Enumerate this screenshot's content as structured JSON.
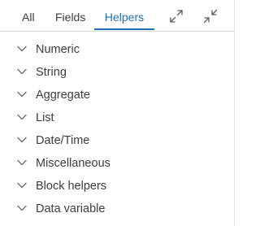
{
  "tabs": {
    "all": "All",
    "fields": "Fields",
    "helpers": "Helpers",
    "active": "helpers"
  },
  "toolbar": {
    "expand_icon": "expand-arrows-icon",
    "collapse_icon": "collapse-arrows-icon"
  },
  "helpers": {
    "items": [
      {
        "label": "Numeric"
      },
      {
        "label": "String"
      },
      {
        "label": "Aggregate"
      },
      {
        "label": "List"
      },
      {
        "label": "Date/Time"
      },
      {
        "label": "Miscellaneous"
      },
      {
        "label": "Block helpers"
      },
      {
        "label": "Data variable"
      }
    ]
  },
  "colors": {
    "accent": "#1f6fb5",
    "text": "#3d3d3d",
    "divider": "#d9d9d9"
  }
}
